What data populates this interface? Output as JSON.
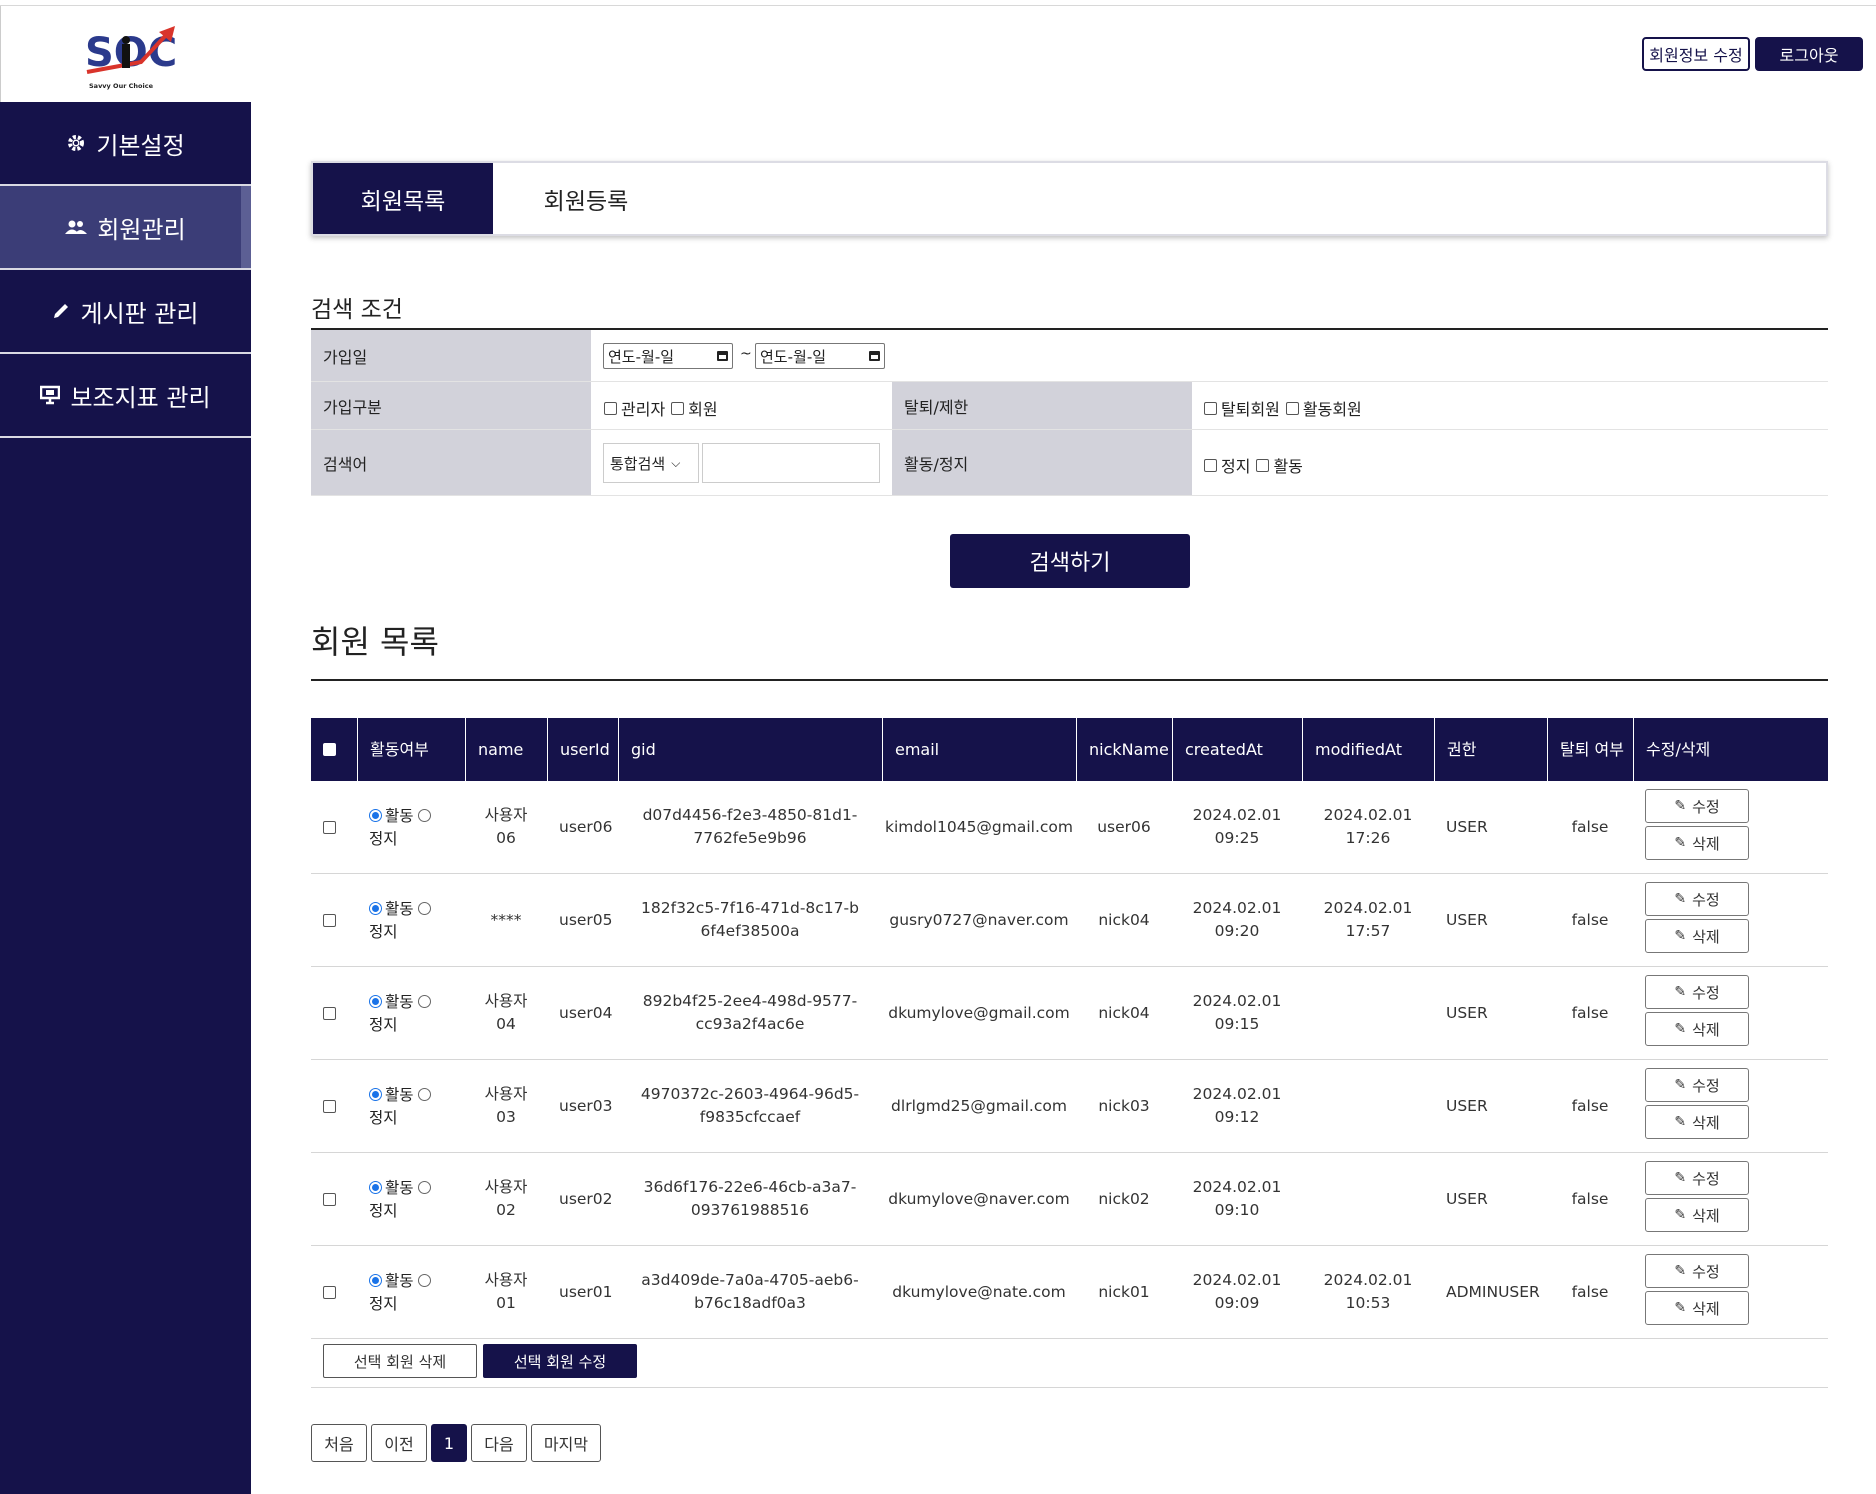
{
  "header": {
    "logo_sub": "Savvy Our Choice",
    "edit_info_label": "회원정보 수정",
    "logout_label": "로그아웃"
  },
  "sidebar": {
    "items": [
      {
        "label": "기본설정",
        "icon": "gear-icon",
        "active": false
      },
      {
        "label": "회원관리",
        "icon": "users-icon",
        "active": true
      },
      {
        "label": "게시판 관리",
        "icon": "pencil-icon",
        "active": false
      },
      {
        "label": "보조지표 관리",
        "icon": "presentation-icon",
        "active": false
      }
    ]
  },
  "tabs": [
    {
      "label": "회원목록",
      "active": true
    },
    {
      "label": "회원등록",
      "active": false
    }
  ],
  "search": {
    "title": "검색 조건",
    "join_date_label": "가입일",
    "date_placeholder_from": "연도-월-일",
    "date_separator": "~",
    "date_placeholder_to": "연도-월-일",
    "join_type_label": "가입구분",
    "join_type_options": [
      "관리자",
      "회원"
    ],
    "withdraw_label": "탈퇴/제한",
    "withdraw_options": [
      "탈퇴회원",
      "활동회원"
    ],
    "keyword_label": "검색어",
    "keyword_select": "통합검색",
    "keyword_value": "",
    "status_label": "활동/정지",
    "status_options": [
      "정지",
      "활동"
    ],
    "button_label": "검색하기"
  },
  "list": {
    "title": "회원 목록",
    "columns": [
      "활동여부",
      "name",
      "userId",
      "gid",
      "email",
      "nickName",
      "createdAt",
      "modifiedAt",
      "권한",
      "탈퇴 여부",
      "수정/삭제"
    ],
    "radio_on_label": "활동",
    "radio_off_label": "정지",
    "edit_label": "수정",
    "delete_label": "삭제",
    "rows": [
      {
        "name": "사용자 06",
        "userId": "user06",
        "gid": "d07d4456-f2e3-4850-81d1-7762fe5e9b96",
        "email": "kimdol1045@gmail.com",
        "nickName": "user06",
        "createdAt": "2024.02.01 09:25",
        "modifiedAt": "2024.02.01 17:26",
        "role": "USER",
        "withdrawn": "false"
      },
      {
        "name": "****",
        "userId": "user05",
        "gid": "182f32c5-7f16-471d-8c17-b6f4ef38500a",
        "email": "gusry0727@naver.com",
        "nickName": "nick04",
        "createdAt": "2024.02.01 09:20",
        "modifiedAt": "2024.02.01 17:57",
        "role": "USER",
        "withdrawn": "false"
      },
      {
        "name": "사용자 04",
        "userId": "user04",
        "gid": "892b4f25-2ee4-498d-9577-cc93a2f4ac6e",
        "email": "dkumylove@gmail.com",
        "nickName": "nick04",
        "createdAt": "2024.02.01 09:15",
        "modifiedAt": "",
        "role": "USER",
        "withdrawn": "false"
      },
      {
        "name": "사용자 03",
        "userId": "user03",
        "gid": "4970372c-2603-4964-96d5-f9835cfccaef",
        "email": "dlrlgmd25@gmail.com",
        "nickName": "nick03",
        "createdAt": "2024.02.01 09:12",
        "modifiedAt": "",
        "role": "USER",
        "withdrawn": "false"
      },
      {
        "name": "사용자 02",
        "userId": "user02",
        "gid": "36d6f176-22e6-46cb-a3a7-093761988516",
        "email": "dkumylove@naver.com",
        "nickName": "nick02",
        "createdAt": "2024.02.01 09:10",
        "modifiedAt": "",
        "role": "USER",
        "withdrawn": "false"
      },
      {
        "name": "사용자 01",
        "userId": "user01",
        "gid": "a3d409de-7a0a-4705-aeb6-b76c18adf0a3",
        "email": "dkumylove@nate.com",
        "nickName": "nick01",
        "createdAt": "2024.02.01 09:09",
        "modifiedAt": "2024.02.01 10:53",
        "role": "ADMINUSER",
        "withdrawn": "false"
      }
    ],
    "bulk_delete_label": "선택 회원 삭제",
    "bulk_edit_label": "선택 회원 수정"
  },
  "pagination": {
    "first": "처음",
    "prev": "이전",
    "pages": [
      "1"
    ],
    "current": "1",
    "next": "다음",
    "last": "마지막"
  },
  "colors": {
    "primary": "#15124a",
    "active_side": "#3b3d77",
    "label_bg": "#d2d2da",
    "radio": "#1a73e8",
    "logo_blue": "#2b3a8c",
    "logo_red": "#d9342b"
  }
}
